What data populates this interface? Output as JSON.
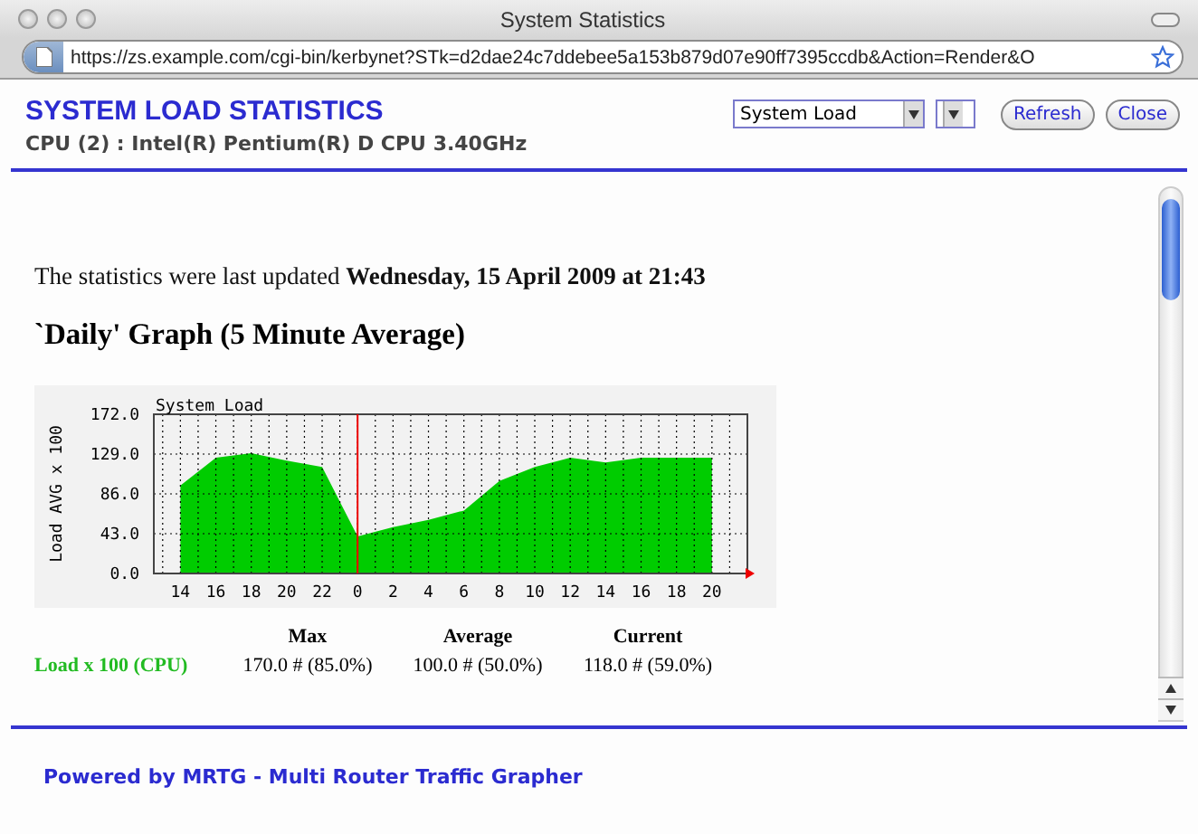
{
  "window": {
    "title": "System Statistics"
  },
  "address_bar": {
    "url": "https://zs.example.com/cgi-bin/kerbynet?STk=d2dae24c7ddebee5a153b879d07e90ff7395ccdb&Action=Render&O"
  },
  "header": {
    "title": "SYSTEM LOAD STATISTICS",
    "subtitle": "CPU (2) : Intel(R) Pentium(R) D CPU 3.40GHz",
    "select": {
      "value": "System Load"
    },
    "buttons": [
      "Refresh",
      "Close"
    ]
  },
  "content": {
    "updated": "The statistics were last updated **Wednesday, 15 April 2009 at 21:43**",
    "graph_title": "`Daily' Graph (5 Minute Average)",
    "graph": {
      "chart_data": {
        "type": "area",
        "title": "System Load",
        "ylabel": "Load AVG x 100",
        "ylim": [
          0,
          172
        ],
        "grid": true,
        "ref_lines": [
          {
            "axis": "x",
            "value": "0",
            "color": "#ee0000"
          }
        ],
        "yticks": [
          {
            "value": 0,
            "label": "0.0"
          },
          {
            "value": 43,
            "label": "43.0"
          },
          {
            "value": 86,
            "label": "86.0"
          },
          {
            "value": 129,
            "label": "129.0"
          },
          {
            "value": 172,
            "label": "172.0"
          }
        ],
        "categories": [
          "14",
          "16",
          "18",
          "20",
          "22",
          "0",
          "2",
          "4",
          "6",
          "8",
          "10",
          "12",
          "14",
          "16",
          "18",
          "20"
        ],
        "series": [
          {
            "name": "Load x 100 (CPU)",
            "color": "#00cc00",
            "values": [
              95,
              125,
              130,
              122,
              115,
              40,
              50,
              58,
              68,
              100,
              115,
              125,
              120,
              125,
              125,
              125
            ]
          }
        ]
      }
    },
    "stats": {
      "columns": [
        "Max",
        "Average",
        "Current"
      ],
      "rows": [
        {
          "cells": [
            "170.0 # (85.0%)",
            "100.0 # (50.0%)",
            "118.0 # (59.0%)"
          ]
        }
      ]
    }
  },
  "footer": {
    "text": "Powered by MRTG - Multi Router Traffic Grapher"
  }
}
